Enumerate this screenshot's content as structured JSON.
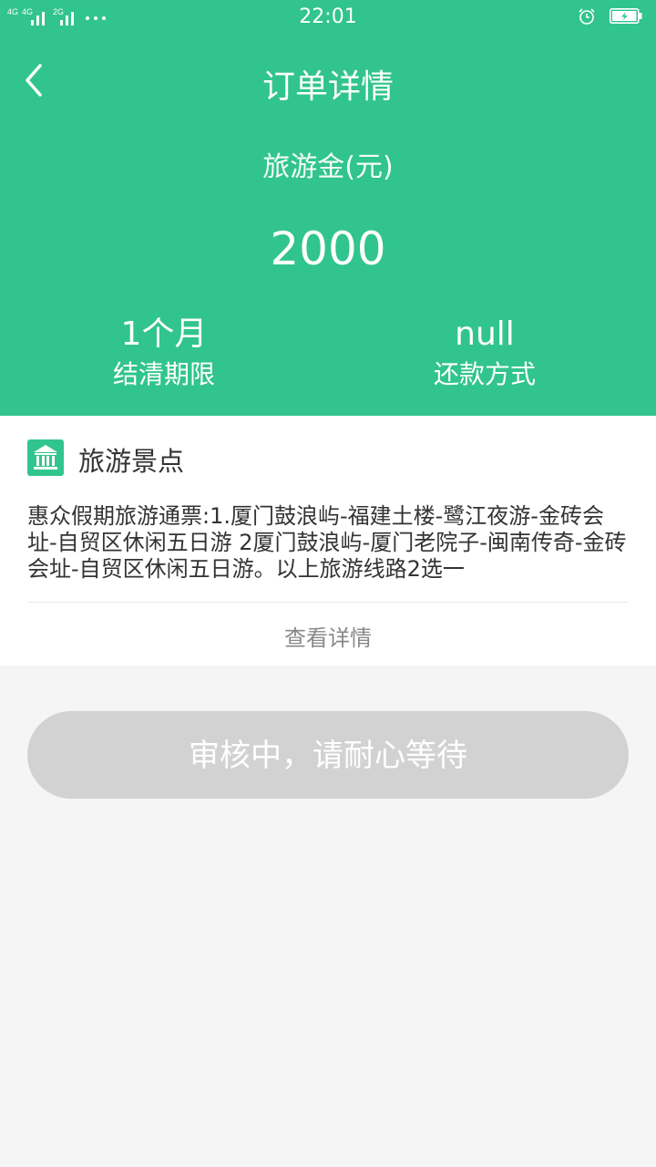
{
  "statusbar": {
    "net1": "4G",
    "net2": "4G",
    "net3": "2G",
    "time": "22:01"
  },
  "nav": {
    "title": "订单详情",
    "back_icon": "chevron-left-icon"
  },
  "summary": {
    "amount_label": "旅游金(元)",
    "amount": "2000",
    "term_value": "1个月",
    "term_label": "结清期限",
    "repay_value": "null",
    "repay_label": "还款方式"
  },
  "attraction": {
    "icon": "bank-building-icon",
    "title": "旅游景点",
    "description": "惠众假期旅游通票:1.厦门鼓浪屿-福建土楼-鹭江夜游-金砖会址-自贸区休闲五日游 2厦门鼓浪屿-厦门老院子-闽南传奇-金砖会址-自贸区休闲五日游。以上旅游线路2选一",
    "more_link": "查看详情"
  },
  "status_button": {
    "label": "审核中，请耐心等待",
    "color": "#d2d2d2"
  },
  "colors": {
    "primary": "#31c48f",
    "background": "#f4f5f4"
  }
}
